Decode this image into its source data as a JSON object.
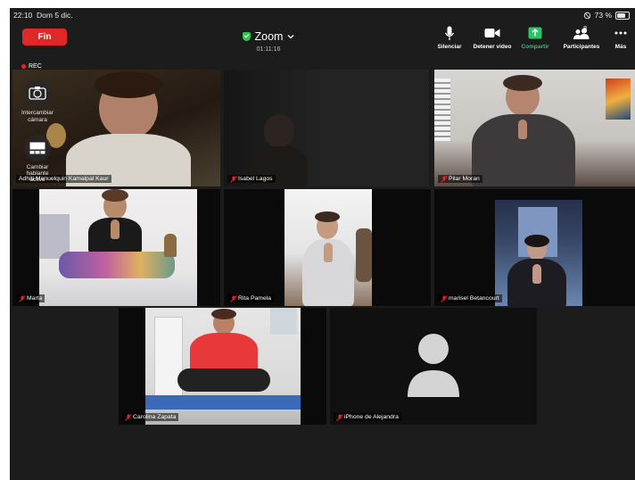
{
  "status_bar": {
    "time": "22:10",
    "date": "Dom 5 dic.",
    "battery": "73 %",
    "battery_level": 0.73
  },
  "toolbar": {
    "end_label": "Fin",
    "title": "Zoom",
    "duration": "01:11:16",
    "items": [
      {
        "label": "Silenciar",
        "icon": "microphone-icon"
      },
      {
        "label": "Detener video",
        "icon": "video-camera-icon"
      },
      {
        "label": "Compartir",
        "icon": "share-screen-icon"
      },
      {
        "label": "Participantes",
        "icon": "participants-icon",
        "badge": "8"
      },
      {
        "label": "Más",
        "icon": "more-icon"
      }
    ]
  },
  "controls": {
    "rec": "REC",
    "switch_camera": "Intercambiar cámara",
    "change_view": "Cambiar hablante activo"
  },
  "participants": [
    {
      "name": "Adhiti Manuelquin Kamalpal Kaur",
      "active": true
    },
    {
      "name": "Isabel Lagos"
    },
    {
      "name": "Pilar Moran"
    },
    {
      "name": "Marta"
    },
    {
      "name": "Rita Pamela"
    },
    {
      "name": "marisel Betancourt"
    },
    {
      "name": "Carolina Zapata"
    },
    {
      "name": "iPhone de Alejandra"
    }
  ],
  "colors": {
    "accent_green": "#34c24e",
    "end_red": "#e02828",
    "share_green": "#2cc46a"
  }
}
